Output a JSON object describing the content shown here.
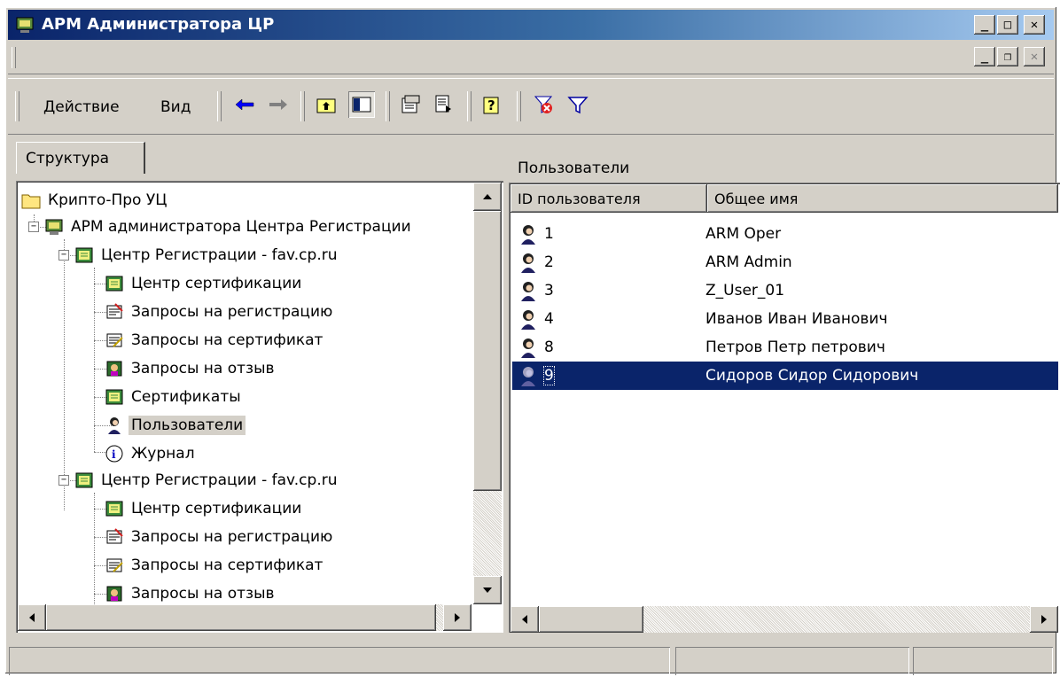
{
  "window": {
    "title": "АРМ Администратора ЦР"
  },
  "toolbar": {
    "menu_action": "Действие",
    "menu_view": "Вид"
  },
  "tabs": [
    {
      "label": "Структура"
    }
  ],
  "tree": [
    {
      "label": "Крипто-Про УЦ",
      "icon": "folder-icon"
    },
    {
      "label": "АРМ администратора Центра Регистрации",
      "icon": "computer-icon"
    },
    {
      "label": "Центр Регистрации - fav.cp.ru",
      "icon": "certificate-icon"
    },
    {
      "label": "Центр сертификации",
      "icon": "certificate-icon"
    },
    {
      "label": "Запросы на регистрацию",
      "icon": "request-icon"
    },
    {
      "label": "Запросы на сертификат",
      "icon": "request-icon"
    },
    {
      "label": "Запросы на отзыв",
      "icon": "revoke-icon"
    },
    {
      "label": "Сертификаты",
      "icon": "certificate-icon"
    },
    {
      "label": "Пользователи",
      "icon": "user-icon",
      "selected": true
    },
    {
      "label": "Журнал",
      "icon": "log-icon"
    },
    {
      "label": "Центр Регистрации - fav.cp.ru",
      "icon": "certificate-icon"
    },
    {
      "label": "Центр сертификации",
      "icon": "certificate-icon"
    },
    {
      "label": "Запросы на регистрацию",
      "icon": "request-icon"
    },
    {
      "label": "Запросы на сертификат",
      "icon": "request-icon"
    },
    {
      "label": "Запросы на отзыв",
      "icon": "revoke-icon"
    }
  ],
  "right": {
    "header": "Пользователи",
    "columns": [
      "ID пользователя",
      "Общее имя"
    ],
    "rows": [
      {
        "id": "1",
        "name": "ARM Oper"
      },
      {
        "id": "2",
        "name": "ARM Admin"
      },
      {
        "id": "3",
        "name": "Z_User_01"
      },
      {
        "id": "4",
        "name": "Иванов Иван Иванович"
      },
      {
        "id": "8",
        "name": "Петров Петр петрович"
      },
      {
        "id": "9",
        "name": "Сидоров Сидор Сидорович",
        "selected": true
      }
    ]
  },
  "colors": {
    "titlebar": "#0a246a",
    "selection": "#0a246a",
    "face": "#d4d0c8"
  }
}
